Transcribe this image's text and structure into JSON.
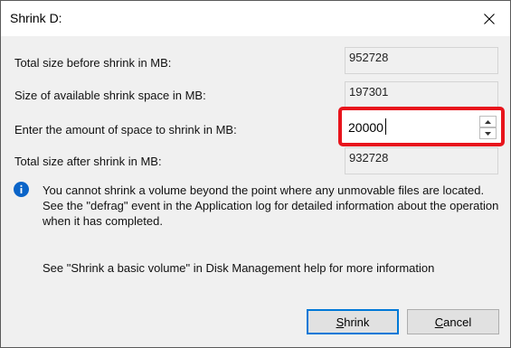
{
  "window": {
    "title": "Shrink D:"
  },
  "fields": {
    "total_before_label": "Total size before shrink in MB:",
    "total_before_value": "952728",
    "available_label": "Size of available shrink space in MB:",
    "available_value": "197301",
    "amount_label": "Enter the amount of space to shrink in MB:",
    "amount_value": "20000",
    "total_after_label": "Total size after shrink in MB:",
    "total_after_value": "932728"
  },
  "info": {
    "message": "You cannot shrink a volume beyond the point where any unmovable files are located. See the \"defrag\" event in the Application log for detailed information about the operation when it has completed.",
    "help": "See \"Shrink a basic volume\" in Disk Management help for more information"
  },
  "buttons": {
    "shrink_mnemonic": "S",
    "shrink_rest": "hrink",
    "cancel_mnemonic": "C",
    "cancel_rest": "ancel"
  },
  "colors": {
    "highlight": "#e8141c",
    "info_icon": "#0a64c8",
    "default_button_border": "#0078d7"
  },
  "icons": [
    "close-icon",
    "spin-up-icon",
    "spin-down-icon",
    "info-icon"
  ]
}
